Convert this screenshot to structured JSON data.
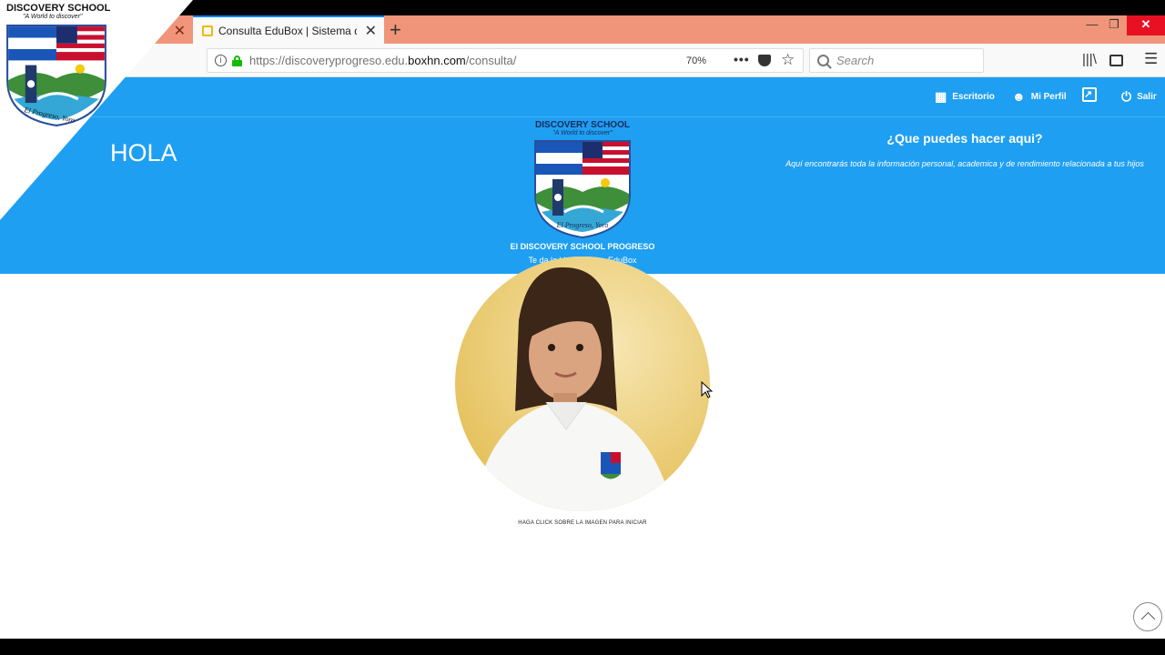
{
  "browser": {
    "active_tab_title": "Consulta EduBox | Sistema de Administración",
    "url_prefix": "https://discoveryprogreso.edu.",
    "url_domain": "boxhn.com",
    "url_path": "/consulta/",
    "zoom": "70%",
    "search_placeholder": "Search",
    "new_tab_label": "+",
    "close_glyph": "✕"
  },
  "nav": {
    "escritorio": "Escritorio",
    "mi_perfil": "Mi Perfil",
    "salir": "Salir"
  },
  "hero": {
    "greeting": "HOLA",
    "school_name": "DISCOVERY SCHOOL",
    "motto": "\"A World to discover\"",
    "crest_caption": "El Progreso, Yoro",
    "welcome_line1": "El DISCOVERY SCHOOL PROGRESO",
    "welcome_line2": "Te da la bienvenida a EduBox",
    "info_title": "¿Que puedes hacer aqui?",
    "info_text": "Aquí encontrarás toda la información personal, academica y de rendimiento relacionada a tus hijos"
  },
  "student": {
    "click_hint": "HAGA CLICK SOBRE LA IMAGEN PARA INICIAR"
  },
  "watermark": {
    "school_name": "DISCOVERY SCHOOL",
    "motto": "\"A World to discover\"",
    "caption": "El Progreso, Yoro"
  },
  "colors": {
    "hero_blue": "#1e9ff2",
    "tabstrip": "#f0957a",
    "close_red": "#e81123"
  }
}
